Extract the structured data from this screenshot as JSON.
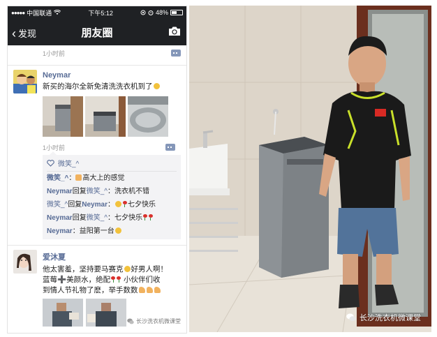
{
  "status_bar": {
    "carrier": "中国联通",
    "time": "下午5:12",
    "battery": "48%"
  },
  "nav": {
    "back_label": "发现",
    "title": "朋友圈"
  },
  "feed": {
    "top_time": "1小时前",
    "post1": {
      "username": "Neymar",
      "text": "新买的海尔全新免清洗洗衣机到了",
      "time": "1小时前",
      "likes": "微笑_^",
      "comments": [
        {
          "author": "微笑_^",
          "sep": "：",
          "text": "高大上的感觉"
        },
        {
          "author": "Neymar",
          "reply": "回复",
          "target": "微笑_^",
          "sep": "：",
          "text": "洗衣机不错"
        },
        {
          "author": "微笑_^",
          "reply": "回复",
          "target": "Neymar",
          "sep": "：",
          "text": "七夕快乐"
        },
        {
          "author": "Neymar",
          "reply": "回复",
          "target": "微笑_^",
          "sep": "：",
          "text": "七夕快乐"
        },
        {
          "author": "Neymar",
          "sep": "：",
          "text": "益阳第一台"
        }
      ]
    },
    "post2": {
      "username": "爱沐夏",
      "line1": "他太害羞，坚持要马赛克",
      "line1b": "好男人啊！",
      "line2a": "蓝莓",
      "line2b": "美颜水，绝配",
      "line2c": "小伙伴们收",
      "line3": "到情人节礼物了麽，举手数数"
    }
  },
  "watermark": {
    "left_text": "长沙洗衣机微课堂",
    "right_text": "长沙洗衣机微课堂"
  },
  "colors": {
    "wechat_link": "#576b95",
    "nav_bg": "#1f2124"
  },
  "icons": [
    "back-chevron-icon",
    "camera-icon",
    "comment-icon",
    "heart-icon",
    "wechat-icon"
  ]
}
